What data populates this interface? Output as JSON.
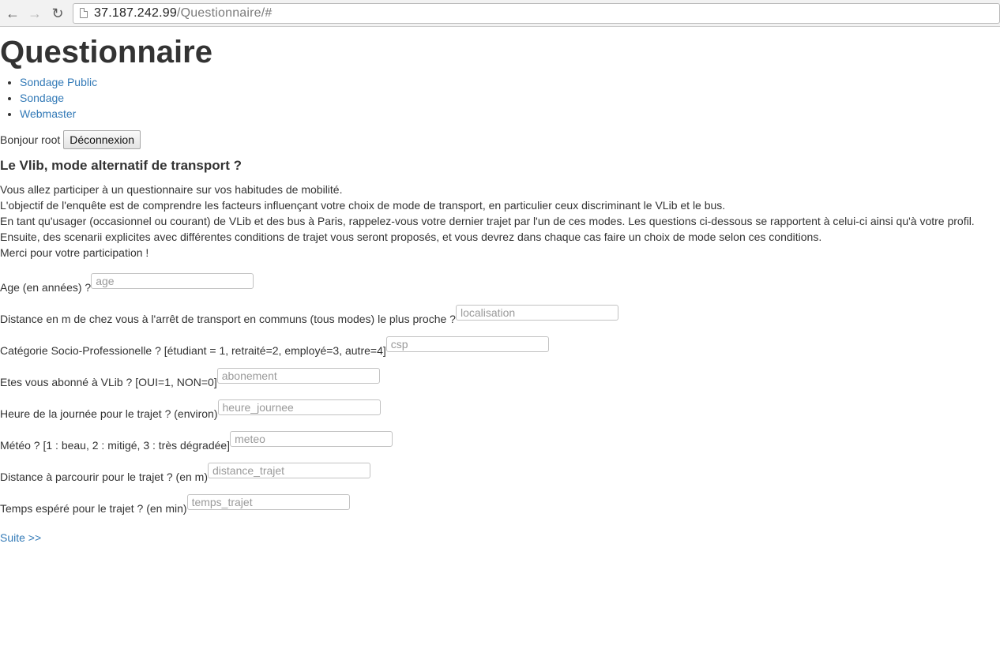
{
  "browser": {
    "url_host": "37.187.242.99",
    "url_path": "/Questionnaire/#"
  },
  "header": {
    "title": "Questionnaire"
  },
  "nav": {
    "items": [
      {
        "label": "Sondage Public"
      },
      {
        "label": "Sondage"
      },
      {
        "label": "Webmaster"
      }
    ]
  },
  "user": {
    "greeting": "Bonjour root",
    "logout_label": "Déconnexion"
  },
  "survey": {
    "title": "Le Vlib, mode alternatif de transport ?",
    "intro": [
      "Vous allez participer à un questionnaire sur vos habitudes de mobilité.",
      "L'objectif de l'enquête est de comprendre les facteurs influençant votre choix de mode de transport, en particulier ceux discriminant le VLib et le bus.",
      "En tant qu'usager (occasionnel ou courant) de VLib et des bus à Paris, rappelez-vous votre dernier trajet par l'un de ces modes. Les questions ci-dessous se rapportent à celui-ci ainsi qu'à votre profil.",
      "Ensuite, des scenarii explicites avec différentes conditions de trajet vous seront proposés, et vous devrez dans chaque cas faire un choix de mode selon ces conditions.",
      "Merci pour votre participation !"
    ],
    "questions": [
      {
        "label": "Age (en années) ?",
        "placeholder": "age",
        "value": ""
      },
      {
        "label": "Distance en m de chez vous à l'arrêt de transport en communs (tous modes) le plus proche ?",
        "placeholder": "localisation",
        "value": ""
      },
      {
        "label": "Catégorie Socio-Professionelle ? [étudiant = 1, retraité=2, employé=3, autre=4]",
        "placeholder": "csp",
        "value": ""
      },
      {
        "label": "Etes vous abonné à VLib ? [OUI=1, NON=0]",
        "placeholder": "abonement",
        "value": ""
      },
      {
        "label": "Heure de la journée pour le trajet ? (environ)",
        "placeholder": "heure_journee",
        "value": ""
      },
      {
        "label": "Météo ? [1 : beau, 2 : mitigé, 3 : très dégradée]",
        "placeholder": "meteo",
        "value": ""
      },
      {
        "label": "Distance à parcourir pour le trajet ? (en m)",
        "placeholder": "distance_trajet",
        "value": ""
      },
      {
        "label": "Temps espéré pour le trajet ? (en min)",
        "placeholder": "temps_trajet",
        "value": ""
      }
    ],
    "next_label": "Suite >>"
  }
}
